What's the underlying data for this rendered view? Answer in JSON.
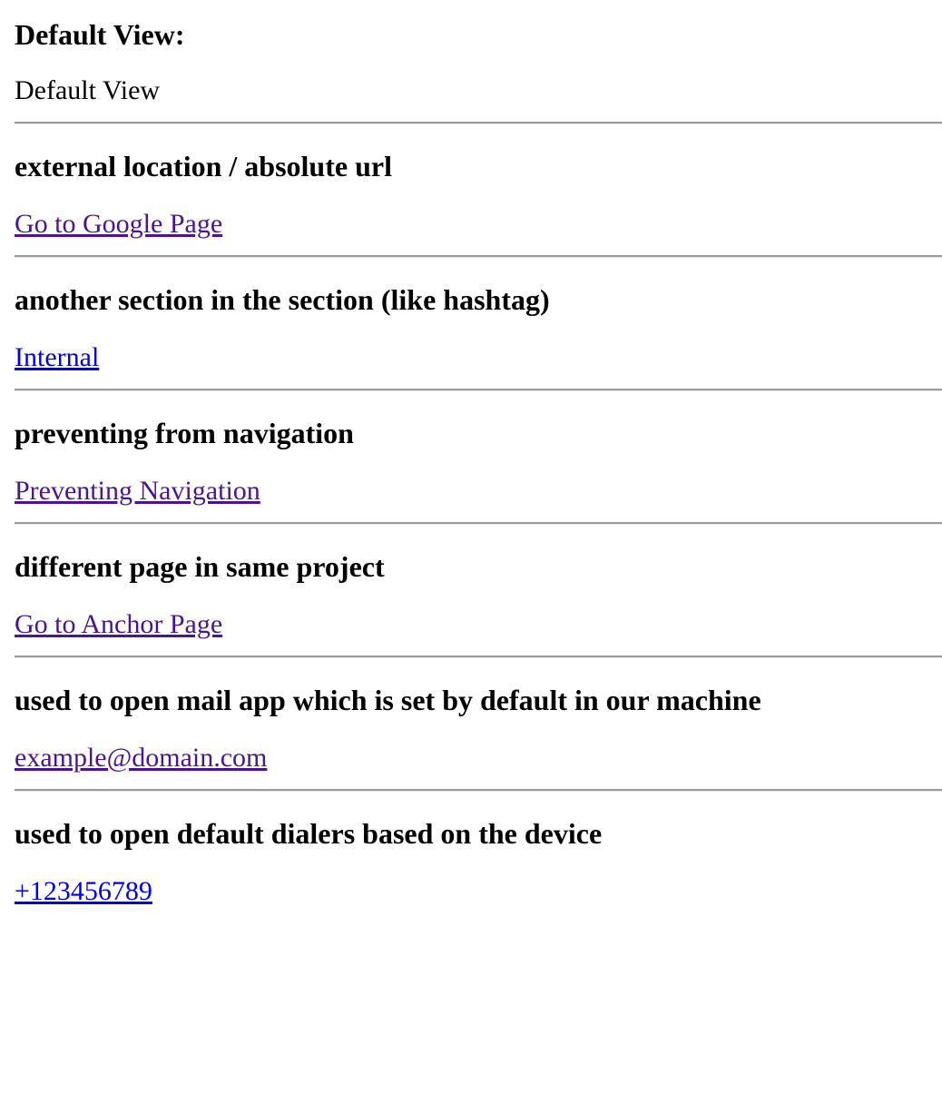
{
  "default_view": {
    "heading": "Default View:",
    "text": "Default View"
  },
  "sections": [
    {
      "heading": "external location / absolute url",
      "link": "Go to Google Page"
    },
    {
      "heading": "another section in the section (like hashtag)",
      "link": "Internal"
    },
    {
      "heading": "preventing from navigation",
      "link": "Preventing Navigation"
    },
    {
      "heading": "different page in same project",
      "link": "Go to Anchor Page"
    },
    {
      "heading": "used to open mail app which is set by default in our machine",
      "link": "example@domain.com"
    },
    {
      "heading": "used to open default dialers based on the device",
      "link": "+123456789"
    }
  ],
  "colors": {
    "visited_link": "#4b1591",
    "unvisited_link": "#0000ee"
  }
}
